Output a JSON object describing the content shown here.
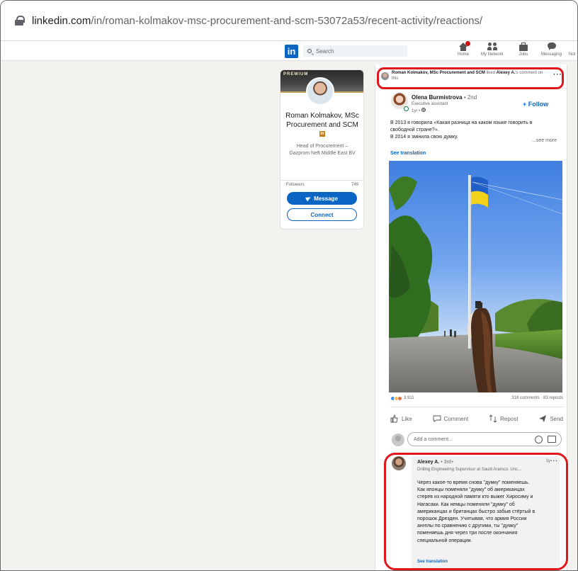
{
  "browser": {
    "url_domain": "linkedin.com",
    "url_path": "/in/roman-kolmakov-msc-procurement-and-scm-53072a53/recent-activity/reactions/"
  },
  "nav": {
    "logo": "in",
    "search_placeholder": "Search",
    "items": [
      "Home",
      "My Network",
      "Jobs",
      "Messaging",
      "Not"
    ]
  },
  "profile": {
    "badge": "PREMIUM",
    "name": "Roman Kolmakov, MSc Procurement and SCM",
    "headline": "Head of Procurement – Gazprom Neft Middle East BV",
    "followers_label": "Followers",
    "followers_count": "749",
    "message_label": "Message",
    "connect_label": "Connect"
  },
  "activity": {
    "actor": "Roman Kolmakov, MSc Procurement and SCM",
    "verb": " liked ",
    "target": "Alexey A.",
    "suffix": "'s comment on this"
  },
  "post": {
    "author": "Olena Burmistrova",
    "degree": "• 2nd",
    "title": "Executive assistant",
    "time": "1yr • ",
    "follow_label": "+ Follow",
    "text_lines": [
      "В 2013 я говорила «Какая разница на каком языке говорить в",
      "свободной стране?».",
      "В 2014 я змінила свою думку."
    ],
    "see_more": "...see more",
    "see_translation": "See translation",
    "reactions_count": "3,911",
    "comments_reposts": "318 comments · 83 reposts"
  },
  "actions": {
    "like": "Like",
    "comment": "Comment",
    "repost": "Repost",
    "send": "Send"
  },
  "comment_box": {
    "placeholder": "Add a comment..."
  },
  "comment": {
    "author": "Alexey A.",
    "degree": "• 3rd+",
    "role": "Drilling Engineering Supervisor at Saudi Aramco, Unc...",
    "time": "1y",
    "lines": [
      "Через какое-то время снова \"думку\" поменяешь.",
      "Как японцы поменяли \"думку\" об американцах",
      "стерев из народной памяти кто выжег Хиросиму и",
      "Нагасаки. Как немцы поменяли \"думку\" об",
      "американцах и британцах быстро забыв стёртый в",
      "порошок Дрезден. Учитывая, что армия России",
      "ангелы по сравнению с другими, ты \"думку\"",
      "поменяешь дня через три после окончания",
      "специальной операции."
    ],
    "see_translation": "See translation"
  },
  "colors": {
    "linkedin_blue": "#0a66c2",
    "highlight_red": "#e0161b",
    "page_bg": "#f3f2ef"
  }
}
